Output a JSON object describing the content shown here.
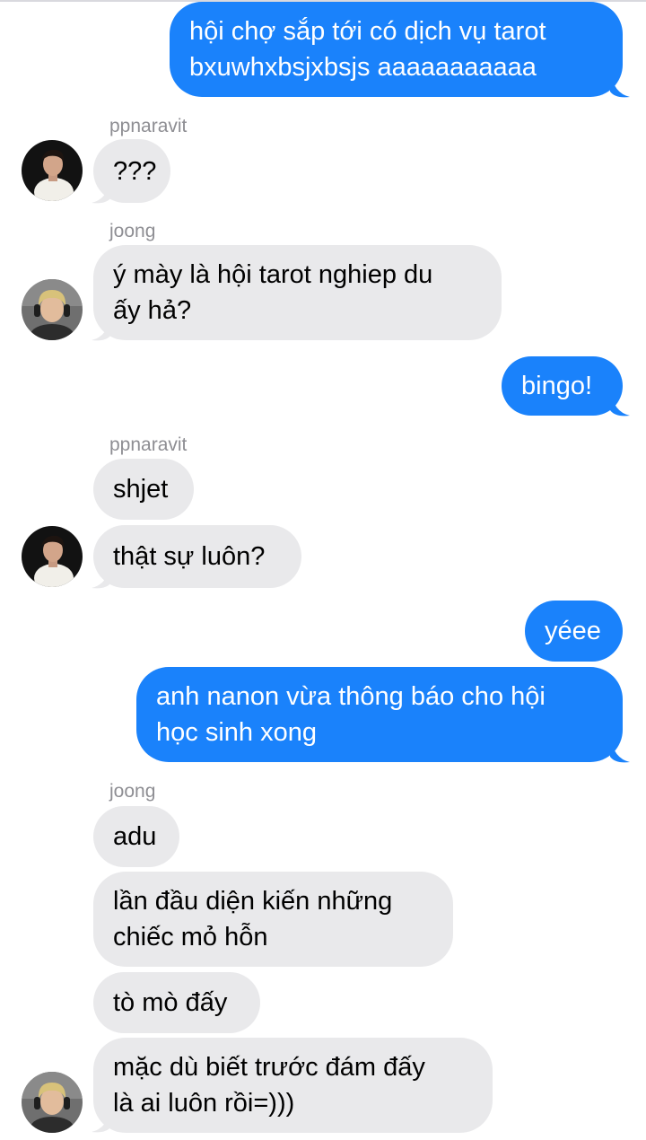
{
  "colors": {
    "outgoing": "#1a82fb",
    "incoming": "#e9e9eb",
    "sender": "#8e8e93"
  },
  "messages": [
    {
      "dir": "out",
      "text": "hội chợ sắp tới có dịch vụ tarot\nbxuwhxbsjxbsjs aaaaaaaaaaa"
    },
    {
      "sender": "ppnaravit"
    },
    {
      "dir": "in",
      "text": "???",
      "avatar": "ppnaravit-avatar"
    },
    {
      "sender": "joong"
    },
    {
      "dir": "in",
      "text": "ý mày là hội tarot nghiep du\nấy hả?",
      "avatar": "joong-avatar"
    },
    {
      "dir": "out",
      "text": "bingo!"
    },
    {
      "sender": "ppnaravit"
    },
    {
      "dir": "in",
      "text": "shjet"
    },
    {
      "dir": "in",
      "text": "thật sự luôn?",
      "avatar": "ppnaravit-avatar"
    },
    {
      "dir": "out",
      "text": "yéee"
    },
    {
      "dir": "out",
      "text": "anh nanon vừa thông báo cho hội\nhọc sinh xong"
    },
    {
      "sender": "joong"
    },
    {
      "dir": "in",
      "text": "adu"
    },
    {
      "dir": "in",
      "text": "lần đầu diện kiến những\nchiếc mỏ hỗn"
    },
    {
      "dir": "in",
      "text": "tò mò đấy"
    },
    {
      "dir": "in",
      "text": "mặc dù biết trước đám đấy\nlà ai luôn rồi=)))",
      "avatar": "joong-avatar"
    }
  ]
}
